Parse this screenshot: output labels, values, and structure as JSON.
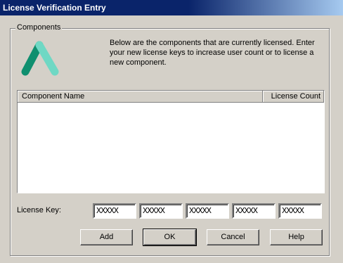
{
  "window": {
    "title": "License Verification Entry"
  },
  "components_group": {
    "legend": "Components",
    "description": "Below are the components that are currently licensed. Enter your new license keys to increase user count or to license a new component.",
    "logo_icon": "stylized-a-logo-icon",
    "logo_colors": [
      "#0f8f6f",
      "#6fd8c4"
    ]
  },
  "list": {
    "columns": [
      "Component Name",
      "License Count"
    ],
    "rows": []
  },
  "license_key": {
    "label": "License Key:",
    "fields": [
      "XXXXX",
      "XXXXX",
      "XXXXX",
      "XXXXX",
      "XXXXX"
    ]
  },
  "buttons": {
    "add": "Add",
    "ok": "OK",
    "cancel": "Cancel",
    "help": "Help"
  }
}
